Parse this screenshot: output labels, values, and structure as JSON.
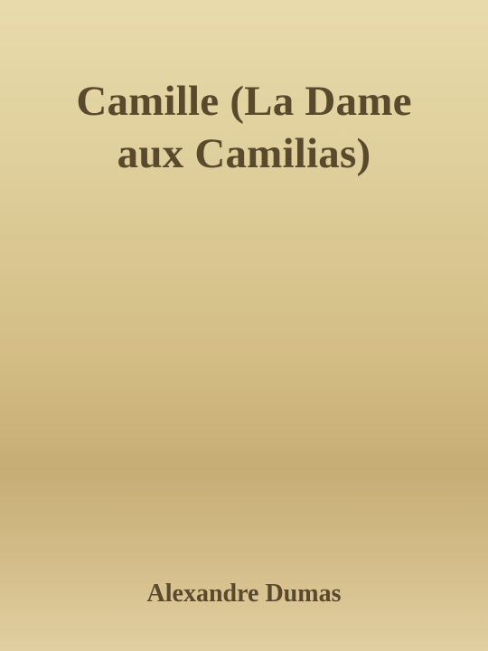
{
  "cover": {
    "title_lines": [
      "Camille (La Dame",
      "aux Camilias)"
    ],
    "author": "Alexandre Dumas"
  },
  "colors": {
    "text": "#5a4a2d",
    "background_top": "#e8dbab",
    "background_mid": "#c6ad75",
    "background_bottom": "#e1cfa1"
  }
}
